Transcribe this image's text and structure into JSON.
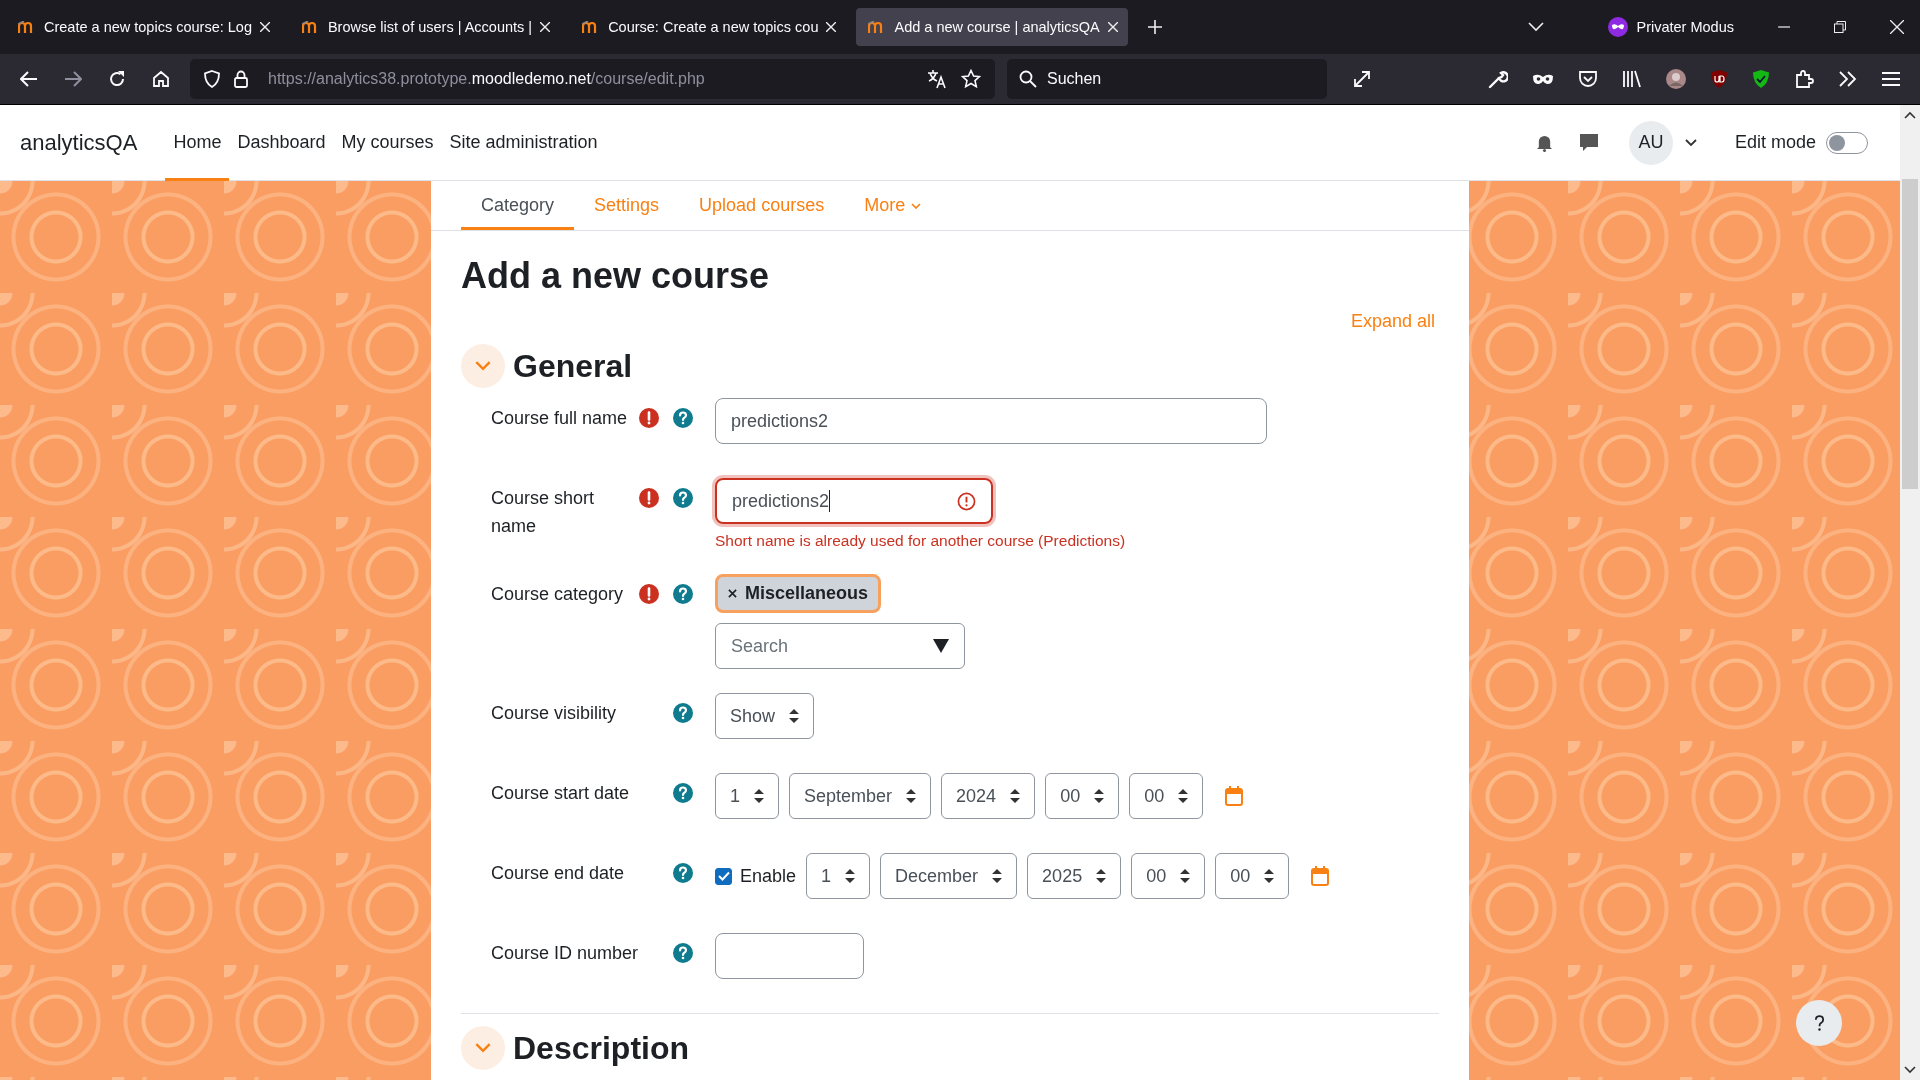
{
  "browser": {
    "tabs": [
      {
        "title": "Create a new topics course: Log",
        "selected": false
      },
      {
        "title": "Browse list of users | Accounts |",
        "selected": false
      },
      {
        "title": "Course: Create a new topics cou",
        "selected": false
      },
      {
        "title": "Add a new course | analyticsQA",
        "selected": true
      }
    ],
    "private_mode": "Privater Modus",
    "url": {
      "prefix": "https://analytics38.prototype.",
      "domain": "moodledemo.net",
      "path": "/course/edit.php"
    },
    "search_placeholder": "Suchen"
  },
  "site": {
    "name": "analyticsQA",
    "nav": [
      {
        "label": "Home",
        "selected": true
      },
      {
        "label": "Dashboard",
        "selected": false
      },
      {
        "label": "My courses",
        "selected": false
      },
      {
        "label": "Site administration",
        "selected": false
      }
    ],
    "avatar": "AU",
    "edit_mode": {
      "label": "Edit mode",
      "on": false
    }
  },
  "secondary_nav": [
    {
      "label": "Category",
      "selected": true,
      "has_menu": false
    },
    {
      "label": "Settings",
      "selected": false,
      "has_menu": false
    },
    {
      "label": "Upload courses",
      "selected": false,
      "has_menu": false
    },
    {
      "label": "More",
      "selected": false,
      "has_menu": true
    }
  ],
  "page_title": "Add a new course",
  "expand_all": "Expand all",
  "sections": [
    {
      "title": "General",
      "expanded": true,
      "fields": [
        {
          "kind": "text",
          "label": "Course full name",
          "required": true,
          "value": "predictions2"
        },
        {
          "kind": "text",
          "label": "Course short name",
          "required": true,
          "value": "predictions2",
          "error": "Short name is already used for another course (Predictions)"
        },
        {
          "kind": "autocomplete",
          "label": "Course category",
          "required": true,
          "chip": "Miscellaneous",
          "placeholder": "Search"
        },
        {
          "kind": "select",
          "label": "Course visibility",
          "required": false,
          "value": "Show"
        },
        {
          "kind": "date",
          "label": "Course start date",
          "required": false,
          "parts": [
            "1",
            "September",
            "2024",
            "00",
            "00"
          ]
        },
        {
          "kind": "date",
          "label": "Course end date",
          "required": false,
          "enable": {
            "label": "Enable",
            "checked": true
          },
          "parts": [
            "1",
            "December",
            "2025",
            "00",
            "00"
          ]
        },
        {
          "kind": "text",
          "label": "Course ID number",
          "required": false
        }
      ]
    },
    {
      "title": "Description",
      "expanded": true
    }
  ]
}
